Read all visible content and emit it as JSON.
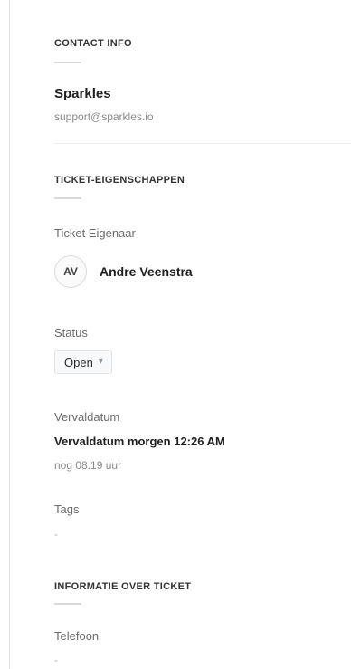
{
  "contact_info": {
    "heading": "CONTACT INFO",
    "name": "Sparkles",
    "email": "support@sparkles.io"
  },
  "ticket_properties": {
    "heading": "TICKET-EIGENSCHAPPEN",
    "owner_label": "Ticket Eigenaar",
    "owner_initials": "AV",
    "owner_name": "Andre Veenstra",
    "status_label": "Status",
    "status_value": "Open",
    "status_chevron": "chevron-down-icon",
    "due_label": "Vervaldatum",
    "due_value": "Vervaldatum morgen 12:26 AM",
    "due_remaining": "nog 08.19 uur",
    "tags_label": "Tags",
    "tags_value": "-"
  },
  "ticket_info": {
    "heading": "INFORMATIE OVER TICKET",
    "phone_label": "Telefoon",
    "phone_value": "-"
  }
}
